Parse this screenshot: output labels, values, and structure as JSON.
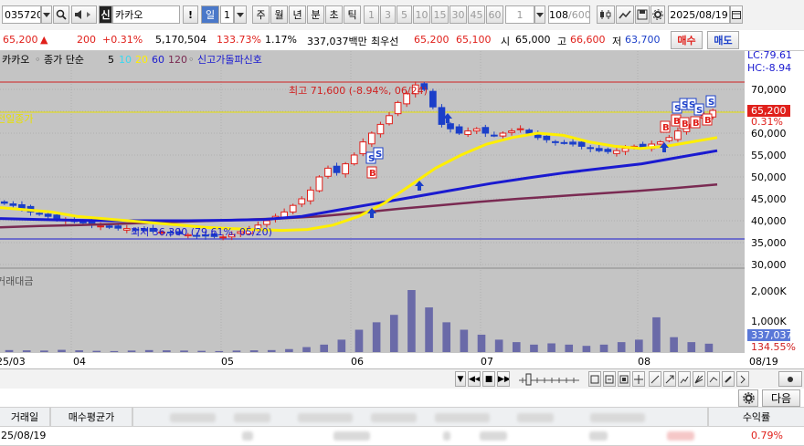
{
  "toolbar": {
    "stock_code": "035720",
    "credit_badge": "신",
    "stock_name": "카카오",
    "alert_mark": "!",
    "period_day": "일",
    "period_day_num": "1",
    "periods": [
      "주",
      "월",
      "년",
      "분",
      "초",
      "틱"
    ],
    "intervals": [
      "1",
      "3",
      "5",
      "10",
      "15",
      "30",
      "45",
      "60"
    ],
    "count_value": "1",
    "page_count": "108",
    "page_total": "/600",
    "date": "2025/08/19"
  },
  "quote": {
    "price": "65,200",
    "change_arrow": "▲",
    "change": "200",
    "change_pct": "+0.31%",
    "volume": "5,170,504",
    "volume_ratio": "133.73%",
    "turnover": "1.17%",
    "amount": "337,037백만",
    "best_label": "최우선",
    "ask": "65,200",
    "bid": "65,100",
    "open_label": "시",
    "open": "65,000",
    "high_label": "고",
    "high": "66,600",
    "low_label": "저",
    "low": "63,700",
    "buy_label": "매수",
    "sell_label": "매도"
  },
  "chart": {
    "legend_name": "카카오",
    "legend_type": "종가 단순",
    "ma_periods": [
      "5",
      "10",
      "20",
      "60",
      "120"
    ],
    "signal_label": "신고가돌파신호",
    "lc_label": "LC:79.61",
    "hc_label": "HC:-8.94",
    "high_annotation": "최고 71,600 (-8.94%, 06/24)",
    "low_annotation": "최저 36,300 (79.61%, 05/20)",
    "prev_close_label": "전일종가",
    "current_price_label": "65,200",
    "current_pct_label": "0.31%",
    "price_axis": [
      "70,000",
      "65,000",
      "60,000",
      "55,000",
      "50,000",
      "45,000",
      "40,000",
      "35,000",
      "30,000"
    ],
    "volume_title": "거래대금",
    "volume_axis": [
      "2,000K",
      "1,000K"
    ],
    "volume_current": "337,037",
    "volume_pct": "134.55%",
    "date_axis": [
      "25/03",
      "04",
      "05",
      "06",
      "07",
      "08",
      "08/19"
    ]
  },
  "colors": {
    "up": "#e0201b",
    "down": "#1b3fc9",
    "ma5": "#000000",
    "ma10": "#39d8f0",
    "ma20": "#ffef00",
    "ma60": "#1a1ad0",
    "ma120": "#7a2a52"
  },
  "chart_data": {
    "type": "line",
    "candle_closes_approx": [
      44000,
      43500,
      42800,
      42000,
      41500,
      41000,
      40500,
      40200,
      39800,
      39500,
      39000,
      38800,
      38500,
      38300,
      38200,
      38000,
      37800,
      37600,
      37400,
      37200,
      37000,
      36800,
      36600,
      36500,
      36400,
      36300,
      36800,
      37500,
      38200,
      39000,
      40000,
      41000,
      42000,
      43500,
      45000,
      47000,
      50000,
      52000,
      51000,
      53000,
      55000,
      58000,
      60000,
      62000,
      64000,
      67000,
      69000,
      71000,
      70000,
      66000,
      62000,
      61000,
      60000,
      60500,
      61000,
      60000,
      59500,
      60000,
      60500,
      61000,
      60000,
      59000,
      58500,
      58000,
      57800,
      57500,
      57000,
      56500,
      56000,
      55800,
      56000,
      56500,
      57000,
      56800,
      57500,
      58000,
      59000,
      60500,
      62000,
      63000,
      64000,
      65200
    ],
    "ma20": [
      43000,
      42500,
      42000,
      41000,
      40500,
      40000,
      39500,
      39000,
      38500,
      38200,
      38000,
      37800,
      38000,
      39000,
      41000,
      44000,
      48000,
      52000,
      55000,
      57500,
      59000,
      60000,
      59500,
      58000,
      57000,
      56500,
      57000,
      58000,
      59000
    ],
    "ma60": [
      40500,
      40300,
      40100,
      40000,
      40000,
      40000,
      40100,
      40300,
      41000,
      42500,
      44000,
      45500,
      47000,
      48500,
      49800,
      51000,
      52000,
      53000,
      54500,
      56000
    ],
    "ma120": [
      38500,
      38800,
      39000,
      39300,
      39600,
      39900,
      40200,
      40500,
      41000,
      41800,
      42700,
      43500,
      44300,
      45000,
      45600,
      46200,
      46800,
      47500,
      48300
    ],
    "volume_approx_K": [
      80,
      70,
      60,
      90,
      70,
      50,
      40,
      60,
      80,
      70,
      60,
      50,
      40,
      60,
      70,
      80,
      120,
      200,
      300,
      500,
      900,
      1200,
      1500,
      2500,
      1800,
      1200,
      900,
      700,
      500,
      400,
      300,
      350,
      300,
      250,
      300,
      400,
      500,
      1400,
      600,
      400,
      337
    ],
    "ylim": [
      30000,
      72000
    ],
    "y_volume_lim": [
      0,
      2500
    ]
  },
  "controls": {
    "stepper_value": "1"
  },
  "table": {
    "headers": [
      "거래일",
      "매수평균가",
      "수익률"
    ],
    "next_label": "다음",
    "row_date": "25/08/19",
    "row_return": "0.79%"
  }
}
